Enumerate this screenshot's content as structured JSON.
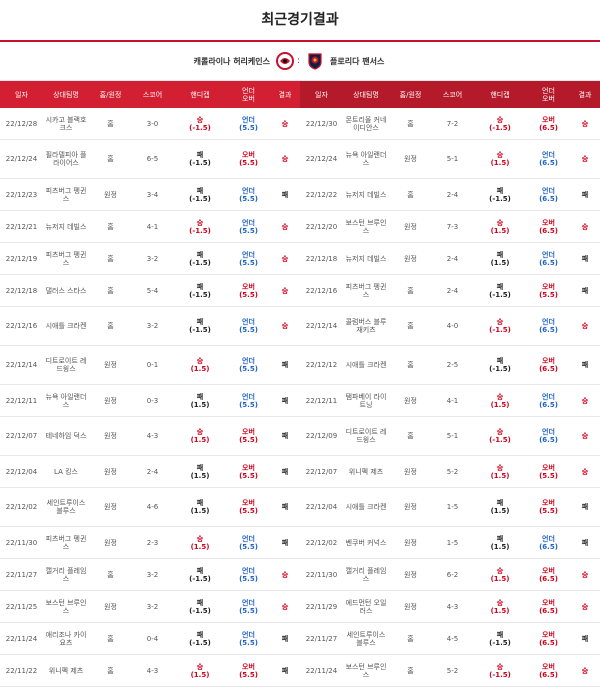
{
  "page_title": "최근경기결과",
  "teams": {
    "left": "캐롤라이나 허리케인스",
    "vs": ":",
    "right": "플로리다 팬서스"
  },
  "columns": [
    "일자",
    "상대팀명",
    "홈/원정",
    "스코어",
    "핸디캡",
    "언더\n오버",
    "결과"
  ],
  "left_rows": [
    {
      "date": "22/12/28",
      "opp": "시카고 블랙호크스",
      "ha": "홈",
      "score": "3-0",
      "hc": "승\n(-1.5)",
      "hc_c": "red",
      "ou": "언더\n(5.5)",
      "ou_c": "blue",
      "res": "승",
      "res_c": "red",
      "h": 31
    },
    {
      "date": "22/12/24",
      "opp": "필라델피아 플라이어스",
      "ha": "홈",
      "score": "6-5",
      "hc": "패\n(-1.5)",
      "hc_c": "black",
      "ou": "오버\n(5.5)",
      "ou_c": "red",
      "res": "승",
      "res_c": "red",
      "h": 38
    },
    {
      "date": "22/12/23",
      "opp": "피츠버그 펭귄스",
      "ha": "원정",
      "score": "3-4",
      "hc": "패\n(-1.5)",
      "hc_c": "black",
      "ou": "언더\n(5.5)",
      "ou_c": "blue",
      "res": "패",
      "res_c": "black",
      "h": 31
    },
    {
      "date": "22/12/21",
      "opp": "뉴저지 데빌스",
      "ha": "홈",
      "score": "4-1",
      "hc": "승\n(-1.5)",
      "hc_c": "red",
      "ou": "언더\n(5.5)",
      "ou_c": "blue",
      "res": "승",
      "res_c": "red",
      "h": 31
    },
    {
      "date": "22/12/19",
      "opp": "피츠버그 펭귄스",
      "ha": "홈",
      "score": "3-2",
      "hc": "패\n(-1.5)",
      "hc_c": "black",
      "ou": "언더\n(5.5)",
      "ou_c": "blue",
      "res": "승",
      "res_c": "red",
      "h": 31
    },
    {
      "date": "22/12/18",
      "opp": "댈러스 스타스",
      "ha": "홈",
      "score": "5-4",
      "hc": "패\n(-1.5)",
      "hc_c": "black",
      "ou": "오버\n(5.5)",
      "ou_c": "red",
      "res": "승",
      "res_c": "red",
      "h": 31
    },
    {
      "date": "22/12/16",
      "opp": "시애틀 크라켄",
      "ha": "홈",
      "score": "3-2",
      "hc": "패\n(-1.5)",
      "hc_c": "black",
      "ou": "언더\n(5.5)",
      "ou_c": "blue",
      "res": "승",
      "res_c": "red",
      "h": 38
    },
    {
      "date": "22/12/14",
      "opp": "디트로이트 레드윙스",
      "ha": "원정",
      "score": "0-1",
      "hc": "승\n(1.5)",
      "hc_c": "red",
      "ou": "언더\n(5.5)",
      "ou_c": "blue",
      "res": "패",
      "res_c": "black",
      "h": 38
    },
    {
      "date": "22/12/11",
      "opp": "뉴욕 아일랜더스",
      "ha": "원정",
      "score": "0-3",
      "hc": "패\n(1.5)",
      "hc_c": "black",
      "ou": "언더\n(5.5)",
      "ou_c": "blue",
      "res": "패",
      "res_c": "black",
      "h": 31
    },
    {
      "date": "22/12/07",
      "opp": "테네하임 덕스",
      "ha": "원정",
      "score": "4-3",
      "hc": "승\n(1.5)",
      "hc_c": "red",
      "ou": "오버\n(5.5)",
      "ou_c": "red",
      "res": "패",
      "res_c": "black",
      "h": 38
    },
    {
      "date": "22/12/04",
      "opp": "LA 킹스",
      "ha": "원정",
      "score": "2-4",
      "hc": "패\n(1.5)",
      "hc_c": "black",
      "ou": "오버\n(5.5)",
      "ou_c": "red",
      "res": "패",
      "res_c": "black",
      "h": 31
    },
    {
      "date": "22/12/02",
      "opp": "세인트루이스 블루스",
      "ha": "원정",
      "score": "4-6",
      "hc": "패\n(1.5)",
      "hc_c": "black",
      "ou": "오버\n(5.5)",
      "ou_c": "red",
      "res": "패",
      "res_c": "black",
      "h": 38
    },
    {
      "date": "22/11/30",
      "opp": "피츠버그 펭귄스",
      "ha": "원정",
      "score": "2-3",
      "hc": "승\n(1.5)",
      "hc_c": "red",
      "ou": "언더\n(5.5)",
      "ou_c": "blue",
      "res": "패",
      "res_c": "black",
      "h": 31
    },
    {
      "date": "22/11/27",
      "opp": "캘거리 플레임스",
      "ha": "홈",
      "score": "3-2",
      "hc": "패\n(-1.5)",
      "hc_c": "black",
      "ou": "언더\n(5.5)",
      "ou_c": "blue",
      "res": "승",
      "res_c": "red",
      "h": 31
    },
    {
      "date": "22/11/25",
      "opp": "보스턴 브루인스",
      "ha": "원정",
      "score": "3-2",
      "hc": "패\n(-1.5)",
      "hc_c": "black",
      "ou": "언더\n(5.5)",
      "ou_c": "blue",
      "res": "승",
      "res_c": "red",
      "h": 31
    },
    {
      "date": "22/11/24",
      "opp": "애리조나 카이요츠",
      "ha": "홈",
      "score": "0-4",
      "hc": "패\n(-1.5)",
      "hc_c": "black",
      "ou": "언더\n(5.5)",
      "ou_c": "blue",
      "res": "패",
      "res_c": "black",
      "h": 31
    },
    {
      "date": "22/11/22",
      "opp": "위니펙 제츠",
      "ha": "홈",
      "score": "4-3",
      "hc": "승\n(1.5)",
      "hc_c": "red",
      "ou": "오버\n(5.5)",
      "ou_c": "red",
      "res": "패",
      "res_c": "black",
      "h": 31
    }
  ],
  "right_rows": [
    {
      "date": "22/12/30",
      "opp": "몬트리올 커네이디안스",
      "ha": "홈",
      "score": "7-2",
      "hc": "승\n(-1.5)",
      "hc_c": "red",
      "ou": "오버\n(6.5)",
      "ou_c": "red",
      "res": "승",
      "res_c": "red"
    },
    {
      "date": "22/12/24",
      "opp": "뉴욕 아일랜더스",
      "ha": "원정",
      "score": "5-1",
      "hc": "승\n(1.5)",
      "hc_c": "red",
      "ou": "언더\n(6.5)",
      "ou_c": "blue",
      "res": "승",
      "res_c": "red"
    },
    {
      "date": "22/12/22",
      "opp": "뉴저지 데빌스",
      "ha": "홈",
      "score": "2-4",
      "hc": "패\n(-1.5)",
      "hc_c": "black",
      "ou": "언더\n(6.5)",
      "ou_c": "blue",
      "res": "패",
      "res_c": "black"
    },
    {
      "date": "22/12/20",
      "opp": "보스턴 브루인스",
      "ha": "원정",
      "score": "7-3",
      "hc": "승\n(1.5)",
      "hc_c": "red",
      "ou": "오버\n(6.5)",
      "ou_c": "red",
      "res": "승",
      "res_c": "red"
    },
    {
      "date": "22/12/18",
      "opp": "뉴저지 데빌스",
      "ha": "원정",
      "score": "2-4",
      "hc": "패\n(1.5)",
      "hc_c": "black",
      "ou": "언더\n(6.5)",
      "ou_c": "blue",
      "res": "패",
      "res_c": "black"
    },
    {
      "date": "22/12/16",
      "opp": "피츠버그 펭귄스",
      "ha": "홈",
      "score": "2-4",
      "hc": "패\n(-1.5)",
      "hc_c": "black",
      "ou": "오버\n(5.5)",
      "ou_c": "red",
      "res": "패",
      "res_c": "black"
    },
    {
      "date": "22/12/14",
      "opp": "콜럼버스 블루재키츠",
      "ha": "홈",
      "score": "4-0",
      "hc": "승\n(-1.5)",
      "hc_c": "red",
      "ou": "언더\n(6.5)",
      "ou_c": "blue",
      "res": "승",
      "res_c": "red"
    },
    {
      "date": "22/12/12",
      "opp": "시애틀 크라켄",
      "ha": "홈",
      "score": "2-5",
      "hc": "패\n(-1.5)",
      "hc_c": "black",
      "ou": "오버\n(6.5)",
      "ou_c": "red",
      "res": "패",
      "res_c": "black"
    },
    {
      "date": "22/12/11",
      "opp": "탬파베이 라이트닝",
      "ha": "원정",
      "score": "4-1",
      "hc": "승\n(1.5)",
      "hc_c": "red",
      "ou": "언더\n(6.5)",
      "ou_c": "blue",
      "res": "승",
      "res_c": "red"
    },
    {
      "date": "22/12/09",
      "opp": "디트로이트 레드윙스",
      "ha": "홈",
      "score": "5-1",
      "hc": "승\n(-1.5)",
      "hc_c": "red",
      "ou": "언더\n(6.5)",
      "ou_c": "blue",
      "res": "승",
      "res_c": "red"
    },
    {
      "date": "22/12/07",
      "opp": "위니펙 제츠",
      "ha": "원정",
      "score": "5-2",
      "hc": "승\n(1.5)",
      "hc_c": "red",
      "ou": "오버\n(5.5)",
      "ou_c": "red",
      "res": "승",
      "res_c": "red"
    },
    {
      "date": "22/12/04",
      "opp": "시애틀 크라켄",
      "ha": "원정",
      "score": "1-5",
      "hc": "패\n(1.5)",
      "hc_c": "black",
      "ou": "오버\n(5.5)",
      "ou_c": "red",
      "res": "패",
      "res_c": "black"
    },
    {
      "date": "22/12/02",
      "opp": "벤쿠버 커넉스",
      "ha": "원정",
      "score": "1-5",
      "hc": "패\n(1.5)",
      "hc_c": "black",
      "ou": "언더\n(6.5)",
      "ou_c": "blue",
      "res": "패",
      "res_c": "black"
    },
    {
      "date": "22/11/30",
      "opp": "캘거리 플레임스",
      "ha": "원정",
      "score": "6-2",
      "hc": "승\n(1.5)",
      "hc_c": "red",
      "ou": "오버\n(6.5)",
      "ou_c": "red",
      "res": "승",
      "res_c": "red"
    },
    {
      "date": "22/11/29",
      "opp": "에드먼턴 오일러스",
      "ha": "원정",
      "score": "4-3",
      "hc": "승\n(1.5)",
      "hc_c": "red",
      "ou": "오버\n(6.5)",
      "ou_c": "red",
      "res": "승",
      "res_c": "red"
    },
    {
      "date": "22/11/27",
      "opp": "세인트루이스 블루스",
      "ha": "홈",
      "score": "4-5",
      "hc": "패\n(-1.5)",
      "hc_c": "black",
      "ou": "오버\n(6.5)",
      "ou_c": "red",
      "res": "패",
      "res_c": "black"
    },
    {
      "date": "22/11/24",
      "opp": "보스턴 브루인스",
      "ha": "홈",
      "score": "5-2",
      "hc": "승\n(-1.5)",
      "hc_c": "red",
      "ou": "오버\n(6.5)",
      "ou_c": "red",
      "res": "승",
      "res_c": "red"
    }
  ],
  "colors": {
    "header_bg": "#d21f32",
    "win": "#d0021b",
    "under": "#1e63c5"
  }
}
